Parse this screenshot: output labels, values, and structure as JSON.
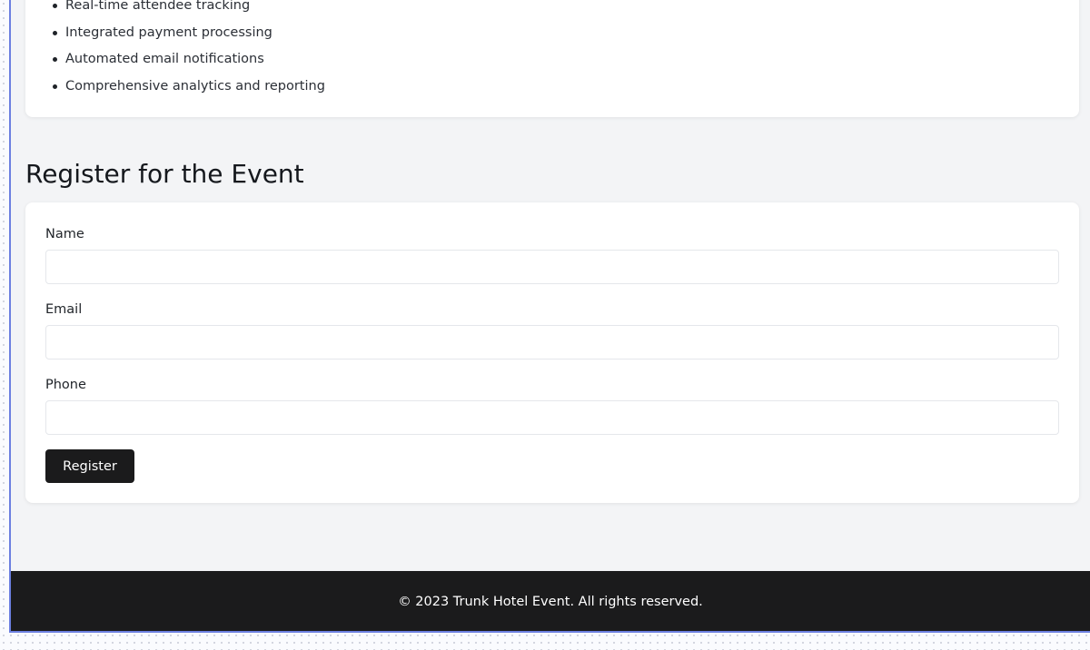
{
  "features": {
    "items": [
      {
        "label": "Real-time attendee tracking"
      },
      {
        "label": "Integrated payment processing"
      },
      {
        "label": "Automated email notifications"
      },
      {
        "label": "Comprehensive analytics and reporting"
      }
    ]
  },
  "registration": {
    "title": "Register for the Event",
    "fields": {
      "name": {
        "label": "Name",
        "value": "",
        "placeholder": ""
      },
      "email": {
        "label": "Email",
        "value": "",
        "placeholder": ""
      },
      "phone": {
        "label": "Phone",
        "value": "",
        "placeholder": ""
      }
    },
    "submit_label": "Register"
  },
  "footer": {
    "copyright": "© 2023 Trunk Hotel Event. All rights reserved."
  },
  "colors": {
    "page_background": "#f3f4f6",
    "card_background": "#ffffff",
    "button_background": "#1b1b1c",
    "footer_background": "#1b1b1c",
    "frame_border": "#6c7fe0"
  }
}
